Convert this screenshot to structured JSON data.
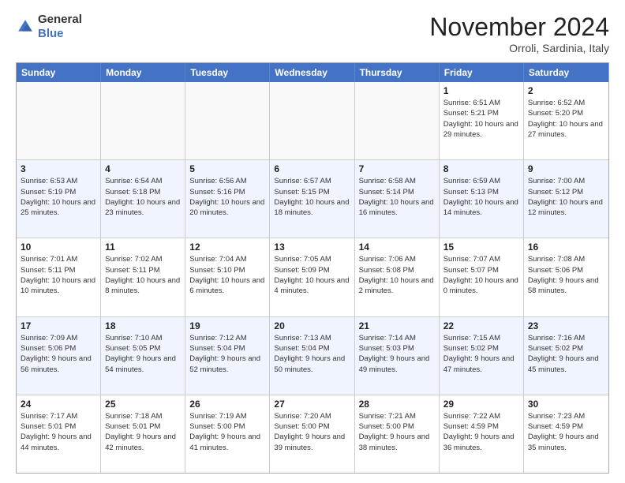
{
  "logo": {
    "general": "General",
    "blue": "Blue"
  },
  "header": {
    "month": "November 2024",
    "location": "Orroli, Sardinia, Italy"
  },
  "weekdays": [
    "Sunday",
    "Monday",
    "Tuesday",
    "Wednesday",
    "Thursday",
    "Friday",
    "Saturday"
  ],
  "rows": [
    [
      {
        "day": "",
        "text": "",
        "empty": true
      },
      {
        "day": "",
        "text": "",
        "empty": true
      },
      {
        "day": "",
        "text": "",
        "empty": true
      },
      {
        "day": "",
        "text": "",
        "empty": true
      },
      {
        "day": "",
        "text": "",
        "empty": true
      },
      {
        "day": "1",
        "text": "Sunrise: 6:51 AM\nSunset: 5:21 PM\nDaylight: 10 hours and 29 minutes."
      },
      {
        "day": "2",
        "text": "Sunrise: 6:52 AM\nSunset: 5:20 PM\nDaylight: 10 hours and 27 minutes."
      }
    ],
    [
      {
        "day": "3",
        "text": "Sunrise: 6:53 AM\nSunset: 5:19 PM\nDaylight: 10 hours and 25 minutes."
      },
      {
        "day": "4",
        "text": "Sunrise: 6:54 AM\nSunset: 5:18 PM\nDaylight: 10 hours and 23 minutes."
      },
      {
        "day": "5",
        "text": "Sunrise: 6:56 AM\nSunset: 5:16 PM\nDaylight: 10 hours and 20 minutes."
      },
      {
        "day": "6",
        "text": "Sunrise: 6:57 AM\nSunset: 5:15 PM\nDaylight: 10 hours and 18 minutes."
      },
      {
        "day": "7",
        "text": "Sunrise: 6:58 AM\nSunset: 5:14 PM\nDaylight: 10 hours and 16 minutes."
      },
      {
        "day": "8",
        "text": "Sunrise: 6:59 AM\nSunset: 5:13 PM\nDaylight: 10 hours and 14 minutes."
      },
      {
        "day": "9",
        "text": "Sunrise: 7:00 AM\nSunset: 5:12 PM\nDaylight: 10 hours and 12 minutes."
      }
    ],
    [
      {
        "day": "10",
        "text": "Sunrise: 7:01 AM\nSunset: 5:11 PM\nDaylight: 10 hours and 10 minutes."
      },
      {
        "day": "11",
        "text": "Sunrise: 7:02 AM\nSunset: 5:11 PM\nDaylight: 10 hours and 8 minutes."
      },
      {
        "day": "12",
        "text": "Sunrise: 7:04 AM\nSunset: 5:10 PM\nDaylight: 10 hours and 6 minutes."
      },
      {
        "day": "13",
        "text": "Sunrise: 7:05 AM\nSunset: 5:09 PM\nDaylight: 10 hours and 4 minutes."
      },
      {
        "day": "14",
        "text": "Sunrise: 7:06 AM\nSunset: 5:08 PM\nDaylight: 10 hours and 2 minutes."
      },
      {
        "day": "15",
        "text": "Sunrise: 7:07 AM\nSunset: 5:07 PM\nDaylight: 10 hours and 0 minutes."
      },
      {
        "day": "16",
        "text": "Sunrise: 7:08 AM\nSunset: 5:06 PM\nDaylight: 9 hours and 58 minutes."
      }
    ],
    [
      {
        "day": "17",
        "text": "Sunrise: 7:09 AM\nSunset: 5:06 PM\nDaylight: 9 hours and 56 minutes."
      },
      {
        "day": "18",
        "text": "Sunrise: 7:10 AM\nSunset: 5:05 PM\nDaylight: 9 hours and 54 minutes."
      },
      {
        "day": "19",
        "text": "Sunrise: 7:12 AM\nSunset: 5:04 PM\nDaylight: 9 hours and 52 minutes."
      },
      {
        "day": "20",
        "text": "Sunrise: 7:13 AM\nSunset: 5:04 PM\nDaylight: 9 hours and 50 minutes."
      },
      {
        "day": "21",
        "text": "Sunrise: 7:14 AM\nSunset: 5:03 PM\nDaylight: 9 hours and 49 minutes."
      },
      {
        "day": "22",
        "text": "Sunrise: 7:15 AM\nSunset: 5:02 PM\nDaylight: 9 hours and 47 minutes."
      },
      {
        "day": "23",
        "text": "Sunrise: 7:16 AM\nSunset: 5:02 PM\nDaylight: 9 hours and 45 minutes."
      }
    ],
    [
      {
        "day": "24",
        "text": "Sunrise: 7:17 AM\nSunset: 5:01 PM\nDaylight: 9 hours and 44 minutes."
      },
      {
        "day": "25",
        "text": "Sunrise: 7:18 AM\nSunset: 5:01 PM\nDaylight: 9 hours and 42 minutes."
      },
      {
        "day": "26",
        "text": "Sunrise: 7:19 AM\nSunset: 5:00 PM\nDaylight: 9 hours and 41 minutes."
      },
      {
        "day": "27",
        "text": "Sunrise: 7:20 AM\nSunset: 5:00 PM\nDaylight: 9 hours and 39 minutes."
      },
      {
        "day": "28",
        "text": "Sunrise: 7:21 AM\nSunset: 5:00 PM\nDaylight: 9 hours and 38 minutes."
      },
      {
        "day": "29",
        "text": "Sunrise: 7:22 AM\nSunset: 4:59 PM\nDaylight: 9 hours and 36 minutes."
      },
      {
        "day": "30",
        "text": "Sunrise: 7:23 AM\nSunset: 4:59 PM\nDaylight: 9 hours and 35 minutes."
      }
    ]
  ]
}
